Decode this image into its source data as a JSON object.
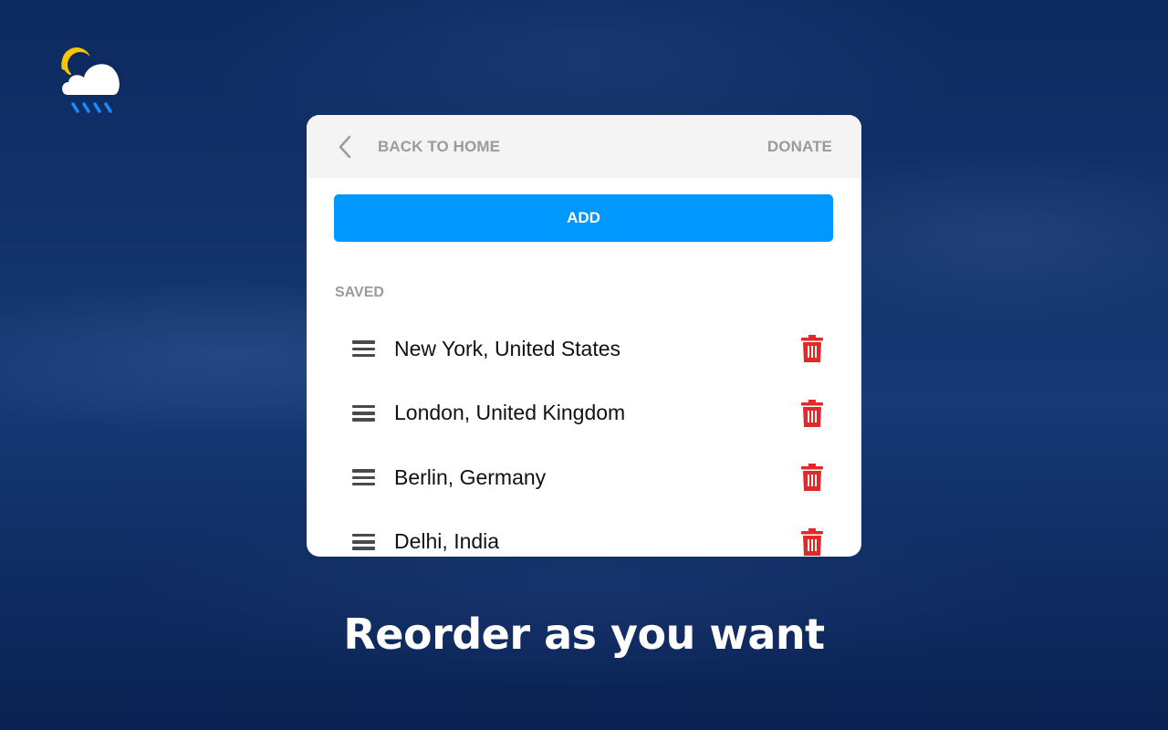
{
  "app": {
    "logo_icon": "sun-cloud-rain-icon",
    "colors": {
      "accent": "#0097ff",
      "delete": "#e02a2a",
      "muted_text": "#9b9b9b",
      "header_bg": "#f4f4f4",
      "sun": "#f7c600",
      "rain": "#1a8cff",
      "background": "#13336b"
    }
  },
  "header": {
    "back_icon": "chevron-left-icon",
    "back_label": "BACK TO HOME",
    "donate_label": "DONATE"
  },
  "actions": {
    "add_label": "ADD"
  },
  "saved": {
    "section_label": "SAVED",
    "drag_icon": "drag-handle-icon",
    "delete_icon": "trash-icon",
    "items": [
      {
        "label": "New York, United States"
      },
      {
        "label": "London, United Kingdom"
      },
      {
        "label": "Berlin, Germany"
      },
      {
        "label": "Delhi, India"
      }
    ]
  },
  "tagline": "Reorder as you want"
}
